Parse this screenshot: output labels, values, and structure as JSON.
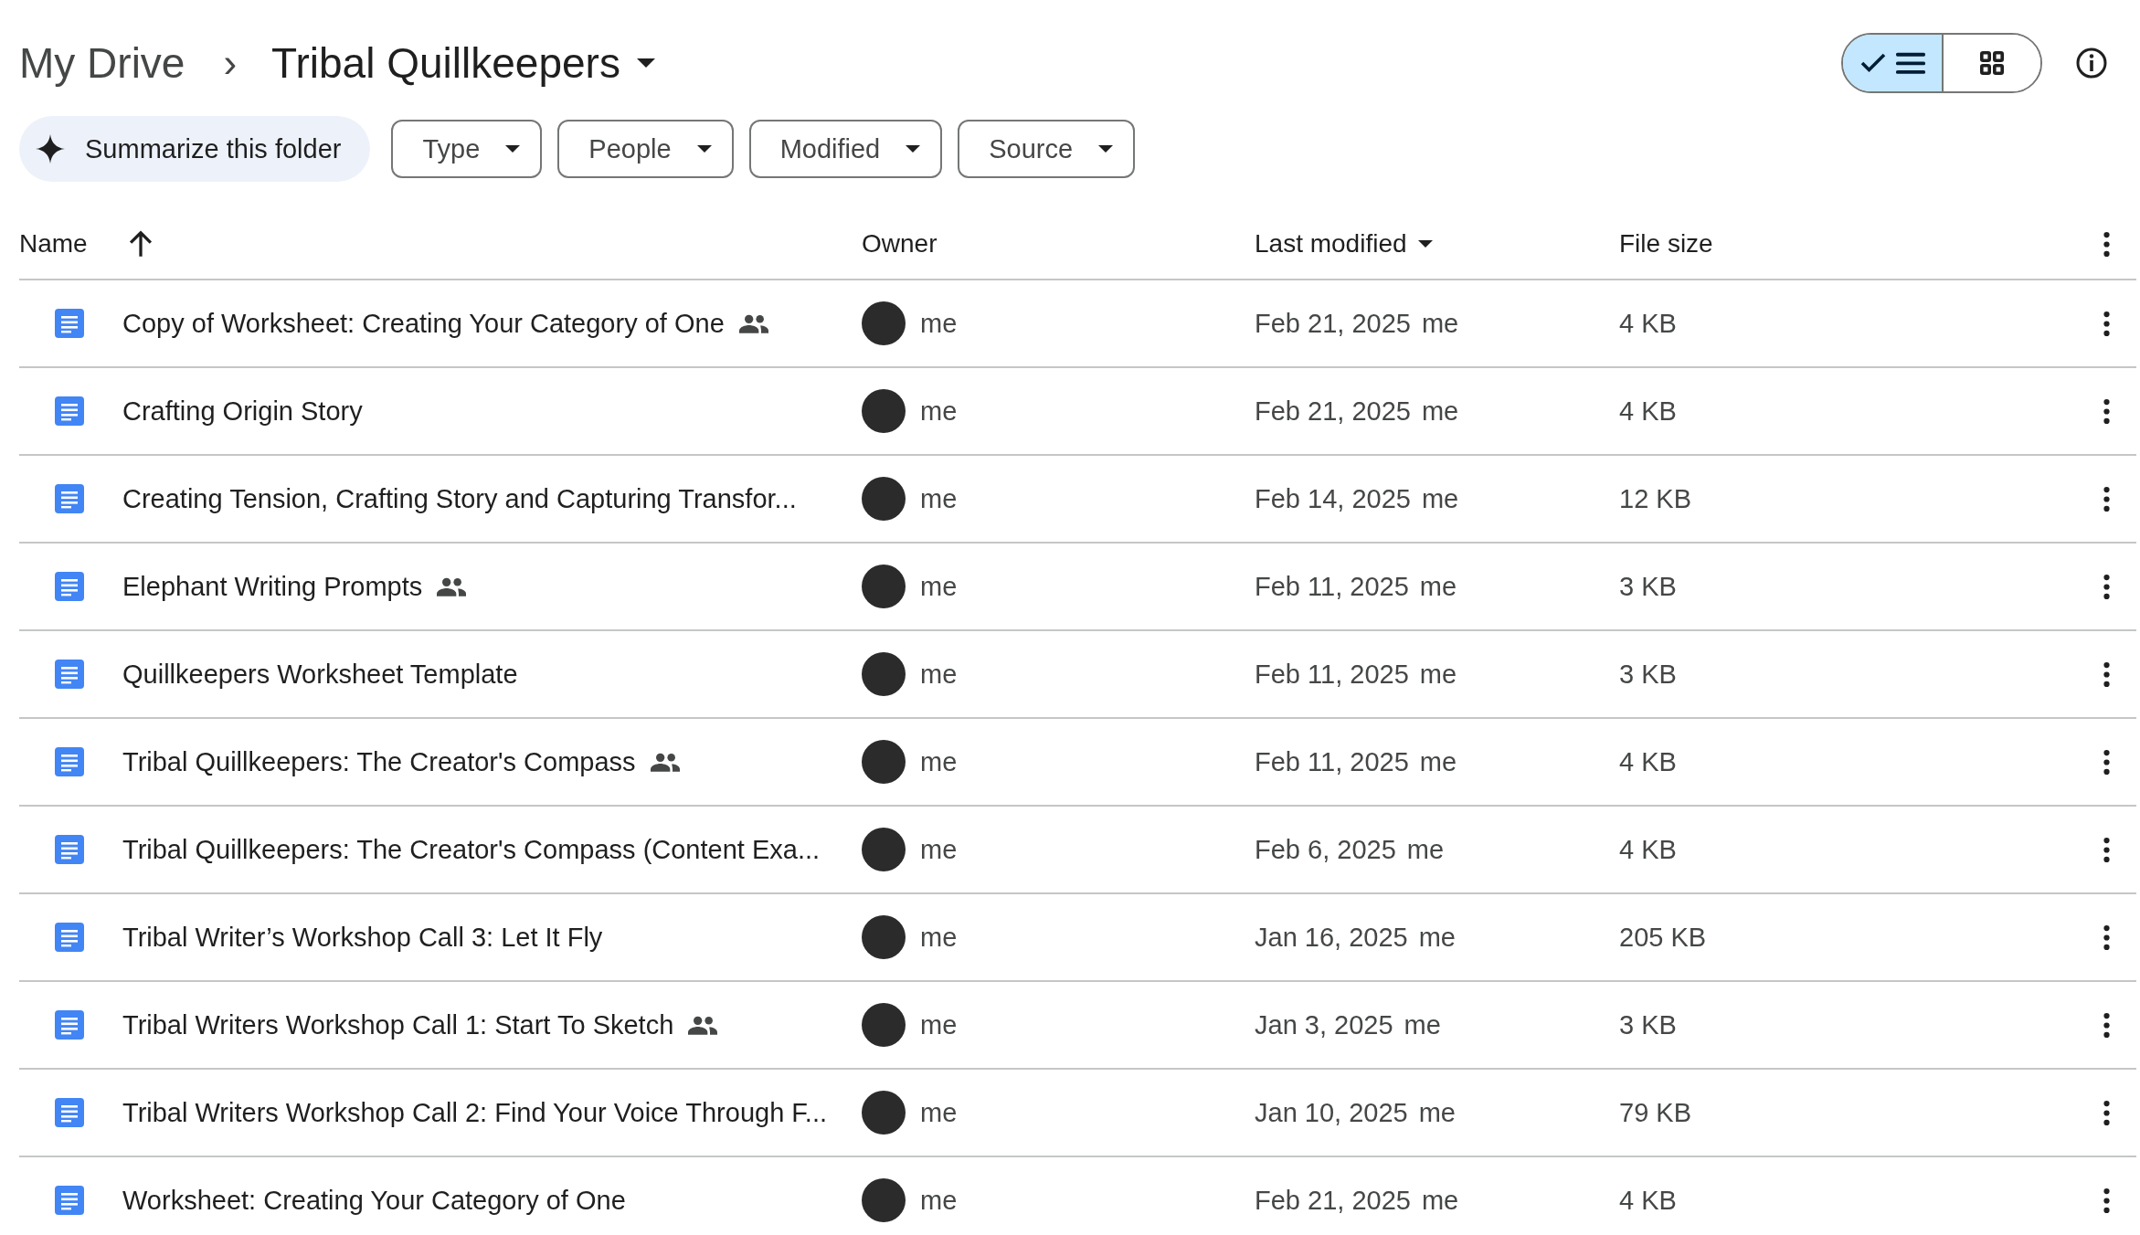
{
  "breadcrumb": {
    "parent": "My Drive",
    "separator": "›",
    "current": "Tribal Quillkeepers"
  },
  "view_toggle": [
    {
      "kind": "list",
      "selected": true
    },
    {
      "kind": "grid",
      "selected": false
    }
  ],
  "summarize_button": "Summarize this folder",
  "filters": [
    "Type",
    "People",
    "Modified",
    "Source"
  ],
  "table": {
    "columns": [
      "Name",
      "Owner",
      "Last modified",
      "File size"
    ],
    "rows": [
      {
        "name": "Copy of Worksheet: Creating Your Category of One",
        "shared": true,
        "owner": "me",
        "modified": "Feb 21, 2025",
        "modified_by": "me",
        "size": "4 KB"
      },
      {
        "name": "Crafting Origin Story",
        "shared": false,
        "owner": "me",
        "modified": "Feb 21, 2025",
        "modified_by": "me",
        "size": "4 KB"
      },
      {
        "name": "Creating Tension, Crafting Story and Capturing Transfor...",
        "shared": false,
        "owner": "me",
        "modified": "Feb 14, 2025",
        "modified_by": "me",
        "size": "12 KB"
      },
      {
        "name": "Elephant Writing Prompts",
        "shared": true,
        "owner": "me",
        "modified": "Feb 11, 2025",
        "modified_by": "me",
        "size": "3 KB"
      },
      {
        "name": "Quillkeepers Worksheet Template",
        "shared": false,
        "owner": "me",
        "modified": "Feb 11, 2025",
        "modified_by": "me",
        "size": "3 KB"
      },
      {
        "name": "Tribal Quillkeepers: The Creator's Compass",
        "shared": true,
        "owner": "me",
        "modified": "Feb 11, 2025",
        "modified_by": "me",
        "size": "4 KB"
      },
      {
        "name": "Tribal Quillkeepers: The Creator's Compass (Content Exa...",
        "shared": false,
        "owner": "me",
        "modified": "Feb 6, 2025",
        "modified_by": "me",
        "size": "4 KB"
      },
      {
        "name": "Tribal Writer’s Workshop Call 3: Let It Fly",
        "shared": false,
        "owner": "me",
        "modified": "Jan 16, 2025",
        "modified_by": "me",
        "size": "205 KB"
      },
      {
        "name": "Tribal Writers Workshop Call 1: Start To Sketch",
        "shared": true,
        "owner": "me",
        "modified": "Jan 3, 2025",
        "modified_by": "me",
        "size": "3 KB"
      },
      {
        "name": "Tribal Writers Workshop Call 2: Find Your Voice Through F...",
        "shared": false,
        "owner": "me",
        "modified": "Jan 10, 2025",
        "modified_by": "me",
        "size": "79 KB"
      },
      {
        "name": "Worksheet: Creating Your Category of One",
        "shared": false,
        "owner": "me",
        "modified": "Feb 21, 2025",
        "modified_by": "me",
        "size": "4 KB"
      }
    ]
  }
}
